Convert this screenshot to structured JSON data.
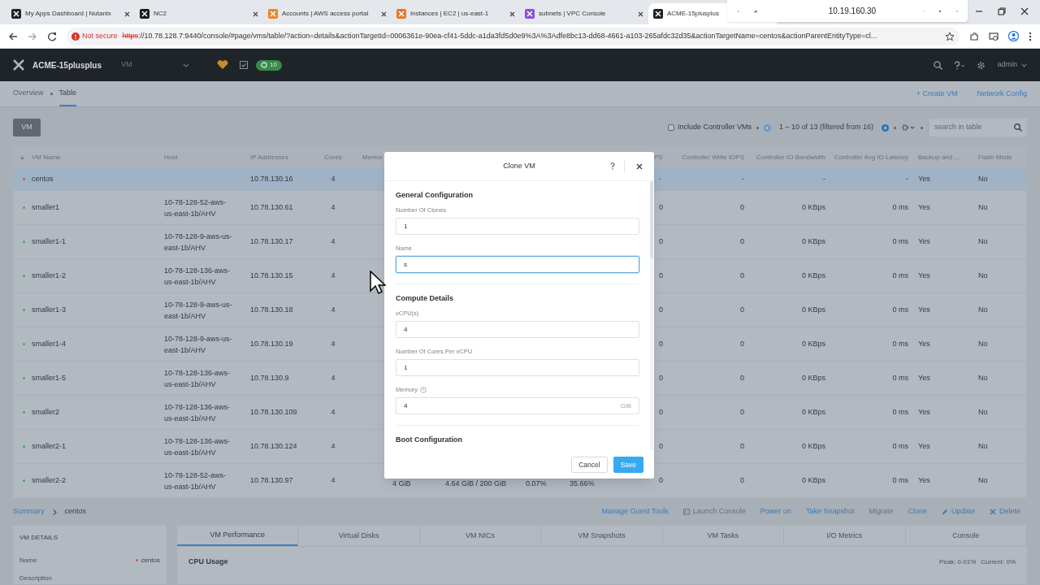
{
  "browser": {
    "tabs": [
      {
        "title": "My Apps Dashboard | Nutanix",
        "color": "#222222",
        "selected": false
      },
      {
        "title": "NC2",
        "color": "#1b1b1b",
        "selected": false
      },
      {
        "title": "Accounts | AWS access portal",
        "color": "#e8872a",
        "selected": false
      },
      {
        "title": "Instances | EC2 | us-east-1",
        "color": "#e8762a",
        "selected": false
      },
      {
        "title": "subnets | VPC Console",
        "color": "#8a4fd8",
        "selected": false
      },
      {
        "title": "ACME-15plusplus",
        "color": "#222222",
        "selected": true
      }
    ],
    "remote_host": "10.19.160.30",
    "not_secure": "Not secure",
    "url_scheme": "https",
    "url_rest": "://10.78.128.7:9440/console/#page/vms/table/?action=details&actionTargetId=0006361e-90ea-cf41-5ddc-a1da3fd5d0e9%3A%3Adfe8bc13-dd68-4661-a103-265afdc32d35&actionTargetName=centos&actionParentEntityType=cl..."
  },
  "app": {
    "cluster": "ACME-15plusplus",
    "entity": "VM",
    "alert_count": "10",
    "user": "admin"
  },
  "subnav": {
    "items": [
      {
        "label": "Overview",
        "selected": false
      },
      {
        "label": "Table",
        "selected": true
      }
    ],
    "actions": [
      "+ Create VM",
      "Network Config"
    ]
  },
  "toolbar": {
    "entity_button": "VM",
    "include_controller": {
      "label": "Include Controller VMs",
      "checked": false
    },
    "range": "1 – 10 of 13 (filtered from 16)",
    "search_placeholder": "search in table"
  },
  "table": {
    "columns": [
      "VM Name",
      "Host",
      "IP Addresses",
      "Cores",
      "Memor",
      "PS",
      "Controller Write IOPS",
      "Controller IO Bandwidth",
      "Controller Avg IO Latency",
      "Backup and ...",
      "Flash Mode"
    ],
    "rows": [
      {
        "name": "centos",
        "color": "#c9534f",
        "ip": "10.78.130.16",
        "cores": "4",
        "selected": true,
        "values": [
          "-",
          "-",
          "-",
          "-",
          "Yes",
          "No"
        ]
      },
      {
        "name": "smaller1",
        "color": "#3fae5b",
        "host": "10-78-128-52-aws-us-east-1b/AHV",
        "ip": "10.78.130.61",
        "cores": "4",
        "selected": false,
        "values": [
          "0",
          "0",
          "0 KBps",
          "0 ms",
          "Yes",
          "No"
        ]
      },
      {
        "name": "smaller1-1",
        "color": "#3fae5b",
        "host": "10-78-128-9-aws-us-east-1b/AHV",
        "ip": "10.78.130.17",
        "cores": "4",
        "selected": false,
        "values": [
          "0",
          "0",
          "0 KBps",
          "0 ms",
          "Yes",
          "No"
        ]
      },
      {
        "name": "smaller1-2",
        "color": "#3fae5b",
        "host": "10-78-128-136-aws-us-east-1b/AHV",
        "ip": "10.78.130.15",
        "cores": "4",
        "selected": false,
        "values": [
          "0",
          "0",
          "0 KBps",
          "0 ms",
          "Yes",
          "No"
        ]
      },
      {
        "name": "smaller1-3",
        "color": "#3fae5b",
        "host": "10-78-128-9-aws-us-east-1b/AHV",
        "ip": "10.78.130.18",
        "cores": "4",
        "selected": false,
        "values": [
          "0",
          "0",
          "0 KBps",
          "0 ms",
          "Yes",
          "No"
        ]
      },
      {
        "name": "smaller1-4",
        "color": "#3fae5b",
        "host": "10-78-128-9-aws-us-east-1b/AHV",
        "ip": "10.78.130.19",
        "cores": "4",
        "selected": false,
        "values": [
          "0",
          "0",
          "0 KBps",
          "0 ms",
          "Yes",
          "No"
        ]
      },
      {
        "name": "smaller1-5",
        "color": "#3fae5b",
        "host": "10-78-128-136-aws-us-east-1b/AHV",
        "ip": "10.78.130.9",
        "cores": "4",
        "selected": false,
        "values": [
          "0",
          "0",
          "0 KBps",
          "0 ms",
          "Yes",
          "No"
        ]
      },
      {
        "name": "smaller2",
        "color": "#3fae5b",
        "host": "10-78-128-136-aws-us-east-1b/AHV",
        "ip": "10.78.130.109",
        "cores": "4",
        "selected": false,
        "values": [
          "0",
          "0",
          "0 KBps",
          "0 ms",
          "Yes",
          "No"
        ]
      },
      {
        "name": "smaller2-1",
        "color": "#3fae5b",
        "host": "10-78-128-136-aws-us-east-1b/AHV",
        "ip": "10.78.130.124",
        "cores": "4",
        "selected": false,
        "values": [
          "0",
          "0",
          "0 KBps",
          "0 ms",
          "Yes",
          "No"
        ]
      },
      {
        "name": "smaller2-2",
        "color": "#3fae5b",
        "host": "10-78-128-52-aws-us-east-1b/AHV",
        "ip": "10.78.130.97",
        "cores": "4",
        "selected": false,
        "middle": [
          "4 GiB",
          "4.64 GiB / 200 GiB",
          "0.07%",
          "35.66%"
        ],
        "values": [
          "0",
          "0",
          "0 KBps",
          "0 ms",
          "Yes",
          "No"
        ]
      }
    ]
  },
  "detail": {
    "breadcrumb": [
      "Summary",
      "centos"
    ],
    "actions": [
      {
        "label": "Manage Guest Tools",
        "kind": "plain",
        "disabled": false
      },
      {
        "label": "Launch Console",
        "kind": "console",
        "disabled": true
      },
      {
        "label": "Power on",
        "kind": "plain",
        "disabled": false
      },
      {
        "label": "Take Snapshot",
        "kind": "plain",
        "disabled": false
      },
      {
        "label": "Migrate",
        "kind": "plain",
        "disabled": true
      },
      {
        "label": "Clone",
        "kind": "plain",
        "disabled": false
      },
      {
        "label": "Update",
        "kind": "edit",
        "disabled": false
      },
      {
        "label": "Delete",
        "kind": "delete",
        "disabled": false
      }
    ],
    "vm_details": {
      "title": "VM DETAILS",
      "fields": [
        {
          "label": "Name",
          "value": "centos",
          "color": "#c9534f"
        },
        {
          "label": "Description"
        }
      ]
    },
    "tabs": [
      {
        "label": "VM Performance",
        "selected": true
      },
      {
        "label": "Virtual Disks",
        "selected": false
      },
      {
        "label": "VM NICs",
        "selected": false
      },
      {
        "label": "VM Snapshots",
        "selected": false
      },
      {
        "label": "VM Tasks",
        "selected": false
      },
      {
        "label": "I/O Metrics",
        "selected": false
      },
      {
        "label": "Console",
        "selected": false
      }
    ],
    "chart_title": "CPU Usage",
    "peak": "Peak: 0.01%",
    "current": "Current: 0%"
  },
  "dialog": {
    "title": "Clone VM",
    "sections": [
      {
        "title": "General Configuration",
        "fields": [
          {
            "label": "Number Of Clones",
            "value": "1",
            "focused": false,
            "help": false
          },
          {
            "label": "Name",
            "value": "s",
            "focused": true,
            "help": false
          }
        ]
      },
      {
        "title": "Compute Details",
        "fields": [
          {
            "label": "vCPU(s)",
            "value": "4",
            "focused": false,
            "help": false
          },
          {
            "label": "Number Of Cores Per vCPU",
            "value": "1",
            "focused": false,
            "help": false
          },
          {
            "label": "Memory",
            "value": "4",
            "unit": "GiB",
            "focused": false,
            "help": true
          }
        ]
      },
      {
        "title": "Boot Configuration"
      }
    ],
    "buttons": [
      {
        "label": "Cancel",
        "kind": "secondary"
      },
      {
        "label": "Save",
        "kind": "primary"
      }
    ]
  }
}
